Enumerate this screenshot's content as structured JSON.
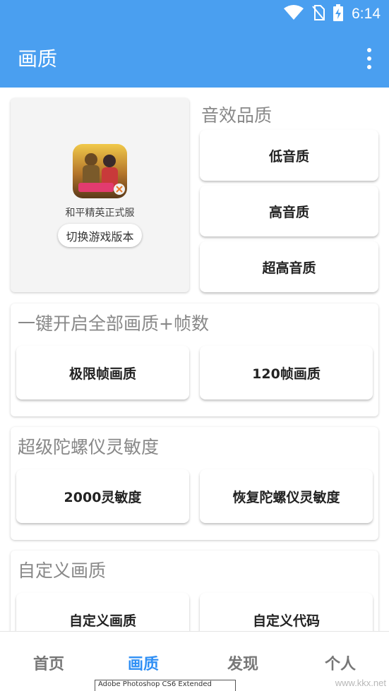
{
  "status_bar": {
    "time": "6:14",
    "icons": [
      "wifi-icon",
      "no-sim-icon",
      "battery-charging-icon"
    ]
  },
  "app_bar": {
    "title": "画质",
    "menu_icon": "more-vert-icon"
  },
  "game": {
    "name": "和平精英正式服",
    "switch_label": "切换游戏版本"
  },
  "sound_quality": {
    "title": "音效品质",
    "buttons": [
      "低音质",
      "高音质",
      "超高音质"
    ]
  },
  "one_click": {
    "title": "一键开启全部画质+帧数",
    "buttons": [
      "极限帧画质",
      "120帧画质"
    ]
  },
  "gyro": {
    "title": "超级陀螺仪灵敏度",
    "buttons": [
      "2000灵敏度",
      "恢复陀螺仪灵敏度"
    ]
  },
  "custom": {
    "title": "自定义画质",
    "buttons": [
      "自定义画质",
      "自定义代码"
    ]
  },
  "bottom_nav": {
    "items": [
      "首页",
      "画质",
      "发现",
      "个人"
    ],
    "active": "画质"
  },
  "watermark": "www.kkx.net",
  "tooltip": "Adobe Photoshop CS6 Extended",
  "colors": {
    "primary": "#4a9ff0",
    "active_tab": "#2f8ff5"
  }
}
